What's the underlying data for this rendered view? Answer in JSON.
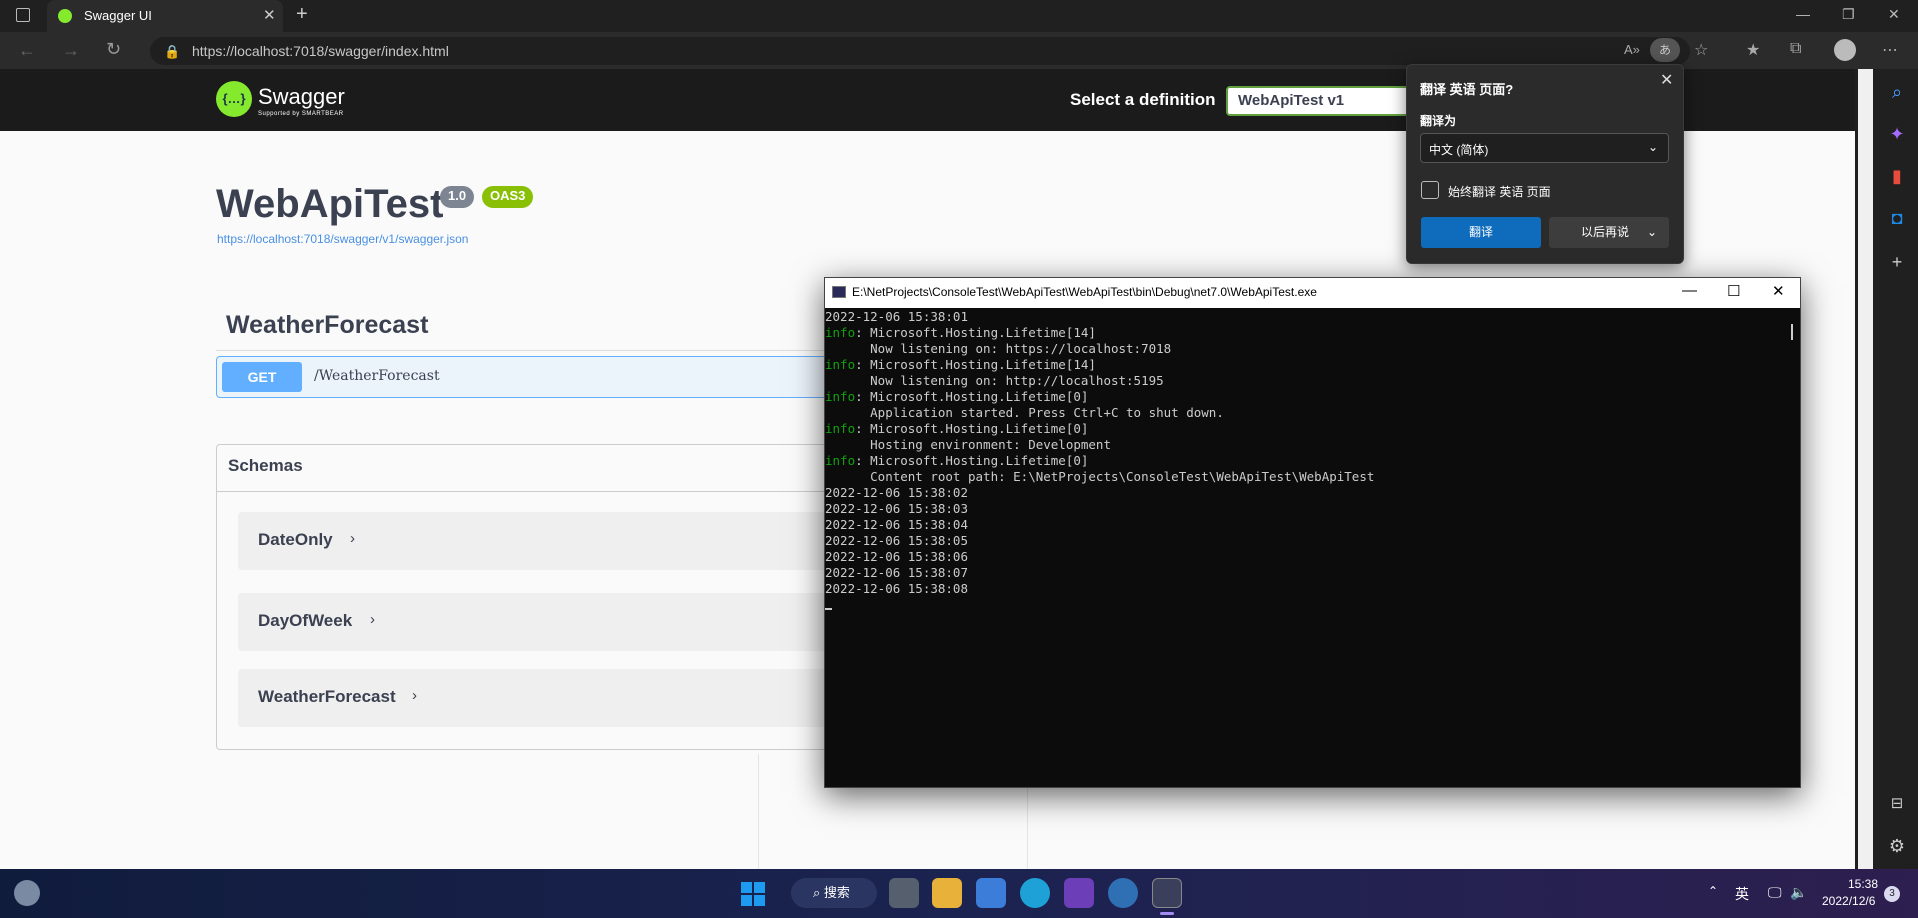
{
  "browser": {
    "tab_title": "Swagger UI",
    "new_tab_symbol": "+",
    "url": "https://localhost:7018/swagger/index.html"
  },
  "swagger": {
    "logo_text": "Swagger",
    "logo_sub": "Supported by SMARTBEAR",
    "definition_label": "Select a definition",
    "definition_value": "WebApiTest v1",
    "api_title": "WebApiTest",
    "version_badge": "1.0",
    "oas_badge": "OAS3",
    "spec_link": "https://localhost:7018/swagger/v1/swagger.json",
    "tag_title": "WeatherForecast",
    "operation": {
      "method": "GET",
      "path": "/WeatherForecast"
    },
    "schemas_title": "Schemas",
    "schemas": [
      "DateOnly",
      "DayOfWeek",
      "WeatherForecast"
    ]
  },
  "translate_popup": {
    "title": "翻译 英语 页面?",
    "target_label": "翻译为",
    "target_value": "中文 (简体)",
    "always_label": "始终翻译 英语 页面",
    "translate_button": "翻译",
    "later_button": "以后再说"
  },
  "console": {
    "title": "E:\\NetProjects\\ConsoleTest\\WebApiTest\\WebApiTest\\bin\\Debug\\net7.0\\WebApiTest.exe",
    "lines": [
      {
        "prefix": "",
        "text": "2022-12-06 15:38:01"
      },
      {
        "prefix": "info",
        "text": ": Microsoft.Hosting.Lifetime[14]"
      },
      {
        "prefix": "",
        "text": "      Now listening on: https://localhost:7018"
      },
      {
        "prefix": "info",
        "text": ": Microsoft.Hosting.Lifetime[14]"
      },
      {
        "prefix": "",
        "text": "      Now listening on: http://localhost:5195"
      },
      {
        "prefix": "info",
        "text": ": Microsoft.Hosting.Lifetime[0]"
      },
      {
        "prefix": "",
        "text": "      Application started. Press Ctrl+C to shut down."
      },
      {
        "prefix": "info",
        "text": ": Microsoft.Hosting.Lifetime[0]"
      },
      {
        "prefix": "",
        "text": "      Hosting environment: Development"
      },
      {
        "prefix": "info",
        "text": ": Microsoft.Hosting.Lifetime[0]"
      },
      {
        "prefix": "",
        "text": "      Content root path: E:\\NetProjects\\ConsoleTest\\WebApiTest\\WebApiTest"
      },
      {
        "prefix": "",
        "text": "2022-12-06 15:38:02"
      },
      {
        "prefix": "",
        "text": "2022-12-06 15:38:03"
      },
      {
        "prefix": "",
        "text": "2022-12-06 15:38:04"
      },
      {
        "prefix": "",
        "text": "2022-12-06 15:38:05"
      },
      {
        "prefix": "",
        "text": "2022-12-06 15:38:06"
      },
      {
        "prefix": "",
        "text": "2022-12-06 15:38:07"
      },
      {
        "prefix": "",
        "text": "2022-12-06 15:38:08"
      }
    ]
  },
  "taskbar": {
    "search_label": "搜索",
    "ime": "英",
    "time": "15:38",
    "date": "2022/12/6",
    "notification_count": "3"
  }
}
